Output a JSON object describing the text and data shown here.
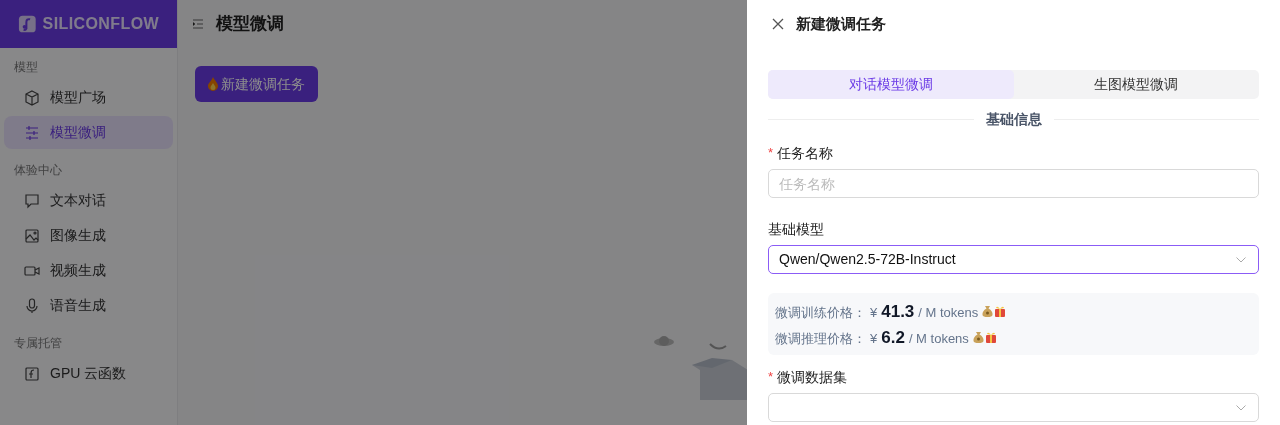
{
  "brand": {
    "name": "SILICONFLOW"
  },
  "sidebar": {
    "groups": [
      {
        "title": "模型",
        "items": [
          {
            "label": "模型广场",
            "selected": false
          },
          {
            "label": "模型微调",
            "selected": true
          }
        ]
      },
      {
        "title": "体验中心",
        "items": [
          {
            "label": "文本对话",
            "selected": false
          },
          {
            "label": "图像生成",
            "selected": false
          },
          {
            "label": "视频生成",
            "selected": false
          },
          {
            "label": "语音生成",
            "selected": false
          }
        ]
      },
      {
        "title": "专属托管",
        "items": [
          {
            "label": "GPU 云函数",
            "selected": false
          }
        ]
      }
    ]
  },
  "page": {
    "title": "模型微调",
    "new_button": "新建微调任务"
  },
  "drawer": {
    "title": "新建微调任务",
    "tabs": [
      {
        "label": "对话模型微调",
        "selected": true
      },
      {
        "label": "生图模型微调",
        "selected": false
      }
    ],
    "section": "基础信息",
    "fields": [
      {
        "kind": "input",
        "required_mark": "*",
        "label": "任务名称",
        "placeholder": "任务名称"
      },
      {
        "kind": "select",
        "label": "基础模型",
        "value": "Qwen/Qwen2.5-72B-Instruct",
        "focused": true
      },
      {
        "kind": "prices",
        "rows": [
          {
            "label": "微调训练价格：",
            "currency": "¥",
            "amount": "41.3",
            "unit": "/ M tokens"
          },
          {
            "label": "微调推理价格：",
            "currency": "¥",
            "amount": "6.2",
            "unit": "/ M tokens"
          }
        ]
      },
      {
        "kind": "select",
        "required_mark": "*",
        "label": "微调数据集",
        "focused": false
      }
    ]
  }
}
